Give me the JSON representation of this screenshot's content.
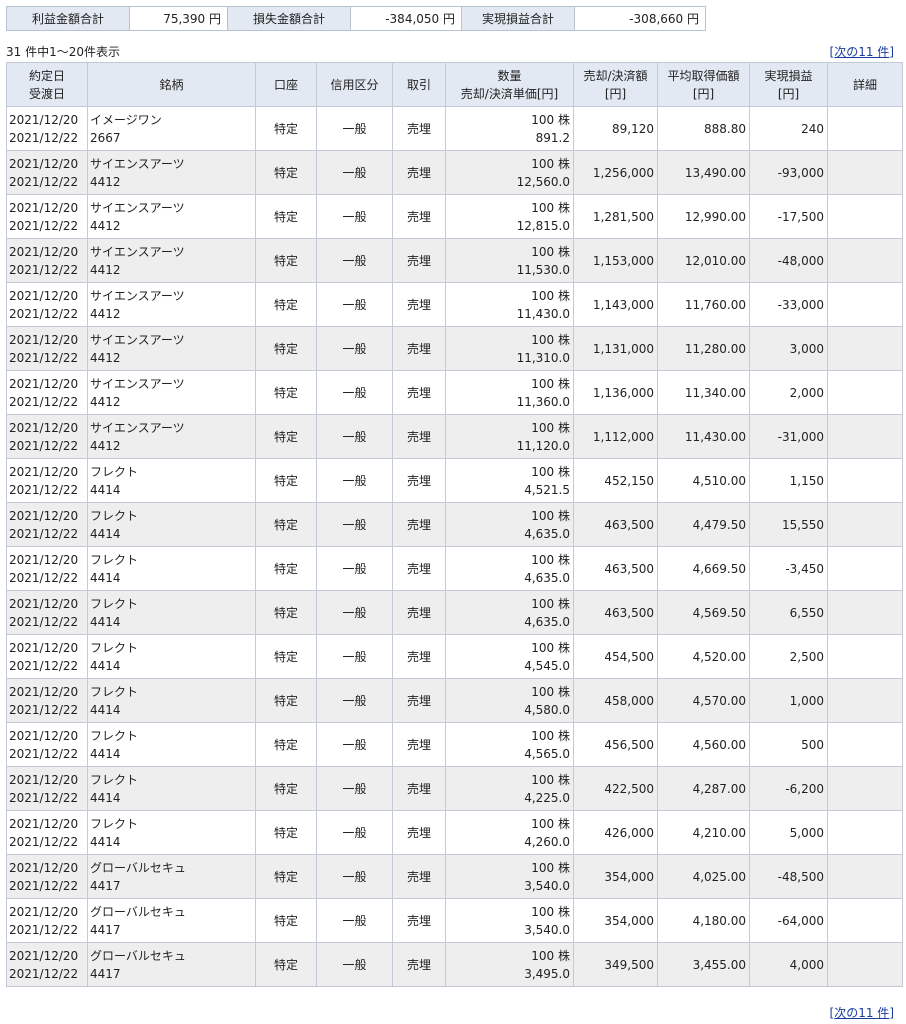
{
  "summary": {
    "profit_label": "利益金額合計",
    "profit_value": "75,390 円",
    "loss_label": "損失金額合計",
    "loss_value": "-384,050 円",
    "realized_label": "実現損益合計",
    "realized_value": "-308,660 円"
  },
  "count_text": "31 件中1～20件表示",
  "next_link": {
    "open": "[",
    "label": "次の11 件",
    "close": "]"
  },
  "headers": {
    "date1": "約定日",
    "date2": "受渡日",
    "name": "銘柄",
    "account": "口座",
    "margin": "信用区分",
    "trade": "取引",
    "qty1": "数量",
    "qty2": "売却/決済単価[円]",
    "amount1": "売却/決済額",
    "amount2": "[円]",
    "avg1": "平均取得価額",
    "avg2": "[円]",
    "pnl1": "実現損益",
    "pnl2": "[円]",
    "detail": "詳細"
  },
  "rows": [
    {
      "trade_date": "2021/12/20",
      "settle_date": "2021/12/22",
      "name": "イメージワン",
      "code": "2667",
      "account": "特定",
      "margin": "一般",
      "trade": "売埋",
      "qty": "100 株",
      "price": "891.2",
      "amount": "89,120",
      "avg": "888.80",
      "pnl": "240"
    },
    {
      "trade_date": "2021/12/20",
      "settle_date": "2021/12/22",
      "name": "サイエンスアーツ",
      "code": "4412",
      "account": "特定",
      "margin": "一般",
      "trade": "売埋",
      "qty": "100 株",
      "price": "12,560.0",
      "amount": "1,256,000",
      "avg": "13,490.00",
      "pnl": "-93,000"
    },
    {
      "trade_date": "2021/12/20",
      "settle_date": "2021/12/22",
      "name": "サイエンスアーツ",
      "code": "4412",
      "account": "特定",
      "margin": "一般",
      "trade": "売埋",
      "qty": "100 株",
      "price": "12,815.0",
      "amount": "1,281,500",
      "avg": "12,990.00",
      "pnl": "-17,500"
    },
    {
      "trade_date": "2021/12/20",
      "settle_date": "2021/12/22",
      "name": "サイエンスアーツ",
      "code": "4412",
      "account": "特定",
      "margin": "一般",
      "trade": "売埋",
      "qty": "100 株",
      "price": "11,530.0",
      "amount": "1,153,000",
      "avg": "12,010.00",
      "pnl": "-48,000"
    },
    {
      "trade_date": "2021/12/20",
      "settle_date": "2021/12/22",
      "name": "サイエンスアーツ",
      "code": "4412",
      "account": "特定",
      "margin": "一般",
      "trade": "売埋",
      "qty": "100 株",
      "price": "11,430.0",
      "amount": "1,143,000",
      "avg": "11,760.00",
      "pnl": "-33,000"
    },
    {
      "trade_date": "2021/12/20",
      "settle_date": "2021/12/22",
      "name": "サイエンスアーツ",
      "code": "4412",
      "account": "特定",
      "margin": "一般",
      "trade": "売埋",
      "qty": "100 株",
      "price": "11,310.0",
      "amount": "1,131,000",
      "avg": "11,280.00",
      "pnl": "3,000"
    },
    {
      "trade_date": "2021/12/20",
      "settle_date": "2021/12/22",
      "name": "サイエンスアーツ",
      "code": "4412",
      "account": "特定",
      "margin": "一般",
      "trade": "売埋",
      "qty": "100 株",
      "price": "11,360.0",
      "amount": "1,136,000",
      "avg": "11,340.00",
      "pnl": "2,000"
    },
    {
      "trade_date": "2021/12/20",
      "settle_date": "2021/12/22",
      "name": "サイエンスアーツ",
      "code": "4412",
      "account": "特定",
      "margin": "一般",
      "trade": "売埋",
      "qty": "100 株",
      "price": "11,120.0",
      "amount": "1,112,000",
      "avg": "11,430.00",
      "pnl": "-31,000"
    },
    {
      "trade_date": "2021/12/20",
      "settle_date": "2021/12/22",
      "name": "フレクト",
      "code": "4414",
      "account": "特定",
      "margin": "一般",
      "trade": "売埋",
      "qty": "100 株",
      "price": "4,521.5",
      "amount": "452,150",
      "avg": "4,510.00",
      "pnl": "1,150"
    },
    {
      "trade_date": "2021/12/20",
      "settle_date": "2021/12/22",
      "name": "フレクト",
      "code": "4414",
      "account": "特定",
      "margin": "一般",
      "trade": "売埋",
      "qty": "100 株",
      "price": "4,635.0",
      "amount": "463,500",
      "avg": "4,479.50",
      "pnl": "15,550"
    },
    {
      "trade_date": "2021/12/20",
      "settle_date": "2021/12/22",
      "name": "フレクト",
      "code": "4414",
      "account": "特定",
      "margin": "一般",
      "trade": "売埋",
      "qty": "100 株",
      "price": "4,635.0",
      "amount": "463,500",
      "avg": "4,669.50",
      "pnl": "-3,450"
    },
    {
      "trade_date": "2021/12/20",
      "settle_date": "2021/12/22",
      "name": "フレクト",
      "code": "4414",
      "account": "特定",
      "margin": "一般",
      "trade": "売埋",
      "qty": "100 株",
      "price": "4,635.0",
      "amount": "463,500",
      "avg": "4,569.50",
      "pnl": "6,550"
    },
    {
      "trade_date": "2021/12/20",
      "settle_date": "2021/12/22",
      "name": "フレクト",
      "code": "4414",
      "account": "特定",
      "margin": "一般",
      "trade": "売埋",
      "qty": "100 株",
      "price": "4,545.0",
      "amount": "454,500",
      "avg": "4,520.00",
      "pnl": "2,500"
    },
    {
      "trade_date": "2021/12/20",
      "settle_date": "2021/12/22",
      "name": "フレクト",
      "code": "4414",
      "account": "特定",
      "margin": "一般",
      "trade": "売埋",
      "qty": "100 株",
      "price": "4,580.0",
      "amount": "458,000",
      "avg": "4,570.00",
      "pnl": "1,000"
    },
    {
      "trade_date": "2021/12/20",
      "settle_date": "2021/12/22",
      "name": "フレクト",
      "code": "4414",
      "account": "特定",
      "margin": "一般",
      "trade": "売埋",
      "qty": "100 株",
      "price": "4,565.0",
      "amount": "456,500",
      "avg": "4,560.00",
      "pnl": "500"
    },
    {
      "trade_date": "2021/12/20",
      "settle_date": "2021/12/22",
      "name": "フレクト",
      "code": "4414",
      "account": "特定",
      "margin": "一般",
      "trade": "売埋",
      "qty": "100 株",
      "price": "4,225.0",
      "amount": "422,500",
      "avg": "4,287.00",
      "pnl": "-6,200"
    },
    {
      "trade_date": "2021/12/20",
      "settle_date": "2021/12/22",
      "name": "フレクト",
      "code": "4414",
      "account": "特定",
      "margin": "一般",
      "trade": "売埋",
      "qty": "100 株",
      "price": "4,260.0",
      "amount": "426,000",
      "avg": "4,210.00",
      "pnl": "5,000"
    },
    {
      "trade_date": "2021/12/20",
      "settle_date": "2021/12/22",
      "name": "グローバルセキュ",
      "code": "4417",
      "account": "特定",
      "margin": "一般",
      "trade": "売埋",
      "qty": "100 株",
      "price": "3,540.0",
      "amount": "354,000",
      "avg": "4,025.00",
      "pnl": "-48,500"
    },
    {
      "trade_date": "2021/12/20",
      "settle_date": "2021/12/22",
      "name": "グローバルセキュ",
      "code": "4417",
      "account": "特定",
      "margin": "一般",
      "trade": "売埋",
      "qty": "100 株",
      "price": "3,540.0",
      "amount": "354,000",
      "avg": "4,180.00",
      "pnl": "-64,000"
    },
    {
      "trade_date": "2021/12/20",
      "settle_date": "2021/12/22",
      "name": "グローバルセキュ",
      "code": "4417",
      "account": "特定",
      "margin": "一般",
      "trade": "売埋",
      "qty": "100 株",
      "price": "3,495.0",
      "amount": "349,500",
      "avg": "3,455.00",
      "pnl": "4,000"
    }
  ]
}
